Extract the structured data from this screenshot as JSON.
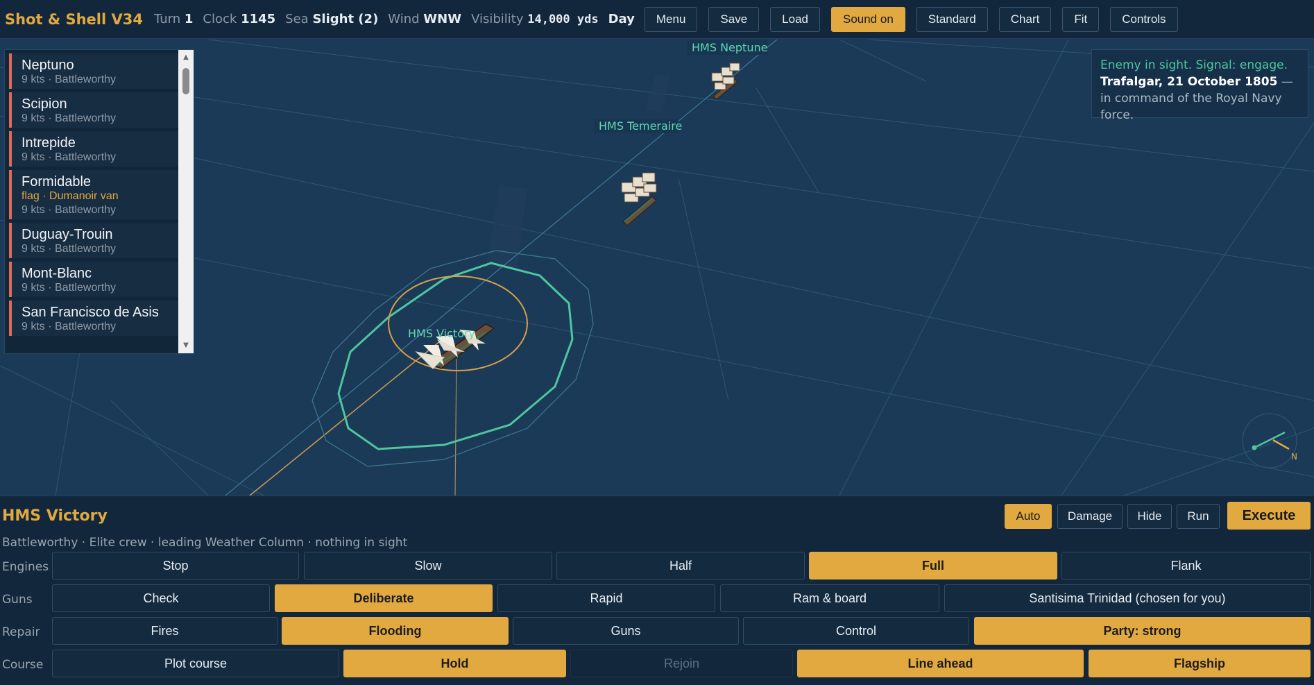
{
  "topbar": {
    "title": "Shot & Shell V34",
    "turn_label": "Turn",
    "turn_value": "1",
    "clock_label": "Clock",
    "clock_value": "1145",
    "sea_label": "Sea",
    "sea_value": "Slight (2)",
    "wind_label": "Wind",
    "wind_value": "WNW",
    "visibility_label": "Visibility",
    "visibility_value": "14,000 yds",
    "daynight": "Day",
    "buttons": {
      "menu": "Menu",
      "save": "Save",
      "load": "Load",
      "sound": "Sound on",
      "standard": "Standard",
      "chart": "Chart",
      "fit": "Fit",
      "controls": "Controls"
    }
  },
  "ship_list": [
    {
      "name": "Neptuno",
      "status": "9 kts · Battleworthy"
    },
    {
      "name": "Scipion",
      "status": "9 kts · Battleworthy"
    },
    {
      "name": "Intrepide",
      "status": "9 kts · Battleworthy"
    },
    {
      "name": "Formidable",
      "flag": "flag · Dumanoir van",
      "status": "9 kts · Battleworthy"
    },
    {
      "name": "Duguay-Trouin",
      "status": "9 kts · Battleworthy"
    },
    {
      "name": "Mont-Blanc",
      "status": "9 kts · Battleworthy"
    },
    {
      "name": "San Francisco de Asis",
      "status": "9 kts · Battleworthy"
    }
  ],
  "map": {
    "ships": {
      "neptune": "HMS Neptune",
      "temeraire": "HMS Temeraire",
      "victory": "HMS Victory"
    },
    "compass_label": "N",
    "colors": {
      "sea": "#1b3a57",
      "friendly_label": "#62d7b0",
      "accent": "#e2a941",
      "enemy_marker": "#e06a5a"
    }
  },
  "message": {
    "signal": "Enemy in sight. Signal: engage.",
    "battle": "Trafalgar, 21 October 1805",
    "rest": " — in command of the Royal Navy force."
  },
  "panel": {
    "ship_name": "HMS Victory",
    "description": "Battleworthy · Elite crew · leading Weather Column · nothing in sight",
    "buttons": {
      "auto": "Auto",
      "damage": "Damage",
      "hide": "Hide",
      "run": "Run",
      "execute": "Execute"
    },
    "rows": {
      "engines": {
        "label": "Engines",
        "options": [
          "Stop",
          "Slow",
          "Half",
          "Full",
          "Flank"
        ]
      },
      "guns": {
        "label": "Guns",
        "options": [
          "Check",
          "Deliberate",
          "Rapid",
          "Ram & board",
          "Santisima Trinidad (chosen for you)"
        ]
      },
      "repair": {
        "label": "Repair",
        "options": [
          "Fires",
          "Flooding",
          "Guns",
          "Control",
          "Party: strong"
        ]
      },
      "course": {
        "label": "Course",
        "options": [
          "Plot course",
          "Hold",
          "Rejoin",
          "Line ahead",
          "Flagship"
        ]
      }
    }
  }
}
